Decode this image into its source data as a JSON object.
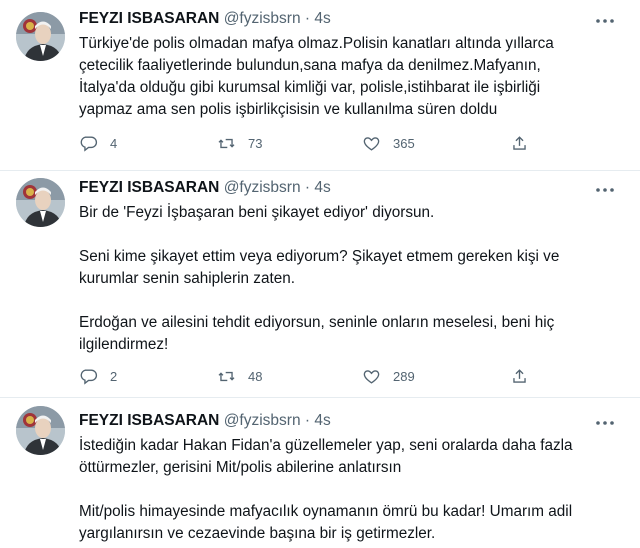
{
  "tweets": [
    {
      "author": "FEYZI ISBASARAN",
      "handle": "@fyzisbsrn",
      "separator": "·",
      "time": "4s",
      "text": "Türkiye'de polis olmadan mafya olmaz.Polisin kanatları altında yıllarca\nçetecilik faaliyetlerinde bulundun,sana mafya da denilmez.Mafyanın,\nİtalya'da olduğu gibi kurumsal kimliği var, polisle,istihbarat ile işbirliği\nyapmaz ama sen polis işbirlikçisisin ve kullanılma süren doldu",
      "replies": "4",
      "retweets": "73",
      "likes": "365"
    },
    {
      "author": "FEYZI ISBASARAN",
      "handle": "@fyzisbsrn",
      "separator": "·",
      "time": "4s",
      "text": "Bir de 'Feyzi İşbaşaran beni şikayet ediyor' diyorsun.\n\nSeni kime şikayet ettim veya ediyorum? Şikayet etmem gereken kişi ve\nkurumlar senin sahiplerin zaten.\n\nErdoğan ve ailesini tehdit ediyorsun, seninle onların meselesi, beni hiç\nilgilendirmez!",
      "replies": "2",
      "retweets": "48",
      "likes": "289"
    },
    {
      "author": "FEYZI ISBASARAN",
      "handle": "@fyzisbsrn",
      "separator": "·",
      "time": "4s",
      "text": "İstediğin kadar Hakan Fidan'a güzellemeler yap, seni oralarda daha fazla\nöttürmezler, gerisini Mit/polis abilerine anlatırsın\n\nMit/polis himayesinde mafyacılık oynamanın ömrü bu kadar! Umarım adil\nyargılanırsın ve cezaevinde başına bir iş getirmezler."
    }
  ],
  "icons": {
    "reply": "reply-icon",
    "retweet": "retweet-icon",
    "like": "heart-icon",
    "share": "share-icon",
    "more": "more-icon"
  },
  "colors": {
    "text": "#0f1419",
    "secondary": "#536471",
    "divider": "#e6ecf0"
  }
}
